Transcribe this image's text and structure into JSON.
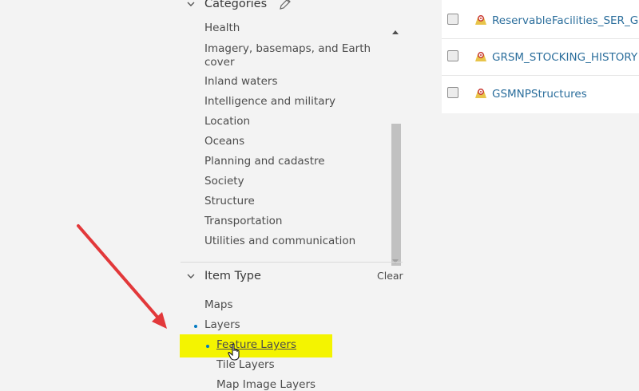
{
  "categories": {
    "heading": "Categories",
    "items": [
      "Health",
      "Imagery, basemaps, and Earth cover",
      "Inland waters",
      "Intelligence and military",
      "Location",
      "Oceans",
      "Planning and cadastre",
      "Society",
      "Structure",
      "Transportation",
      "Utilities and communication"
    ],
    "imagery_line1": "Imagery, basemaps, and Earth",
    "imagery_line2": "cover"
  },
  "item_type": {
    "heading": "Item Type",
    "clear_label": "Clear",
    "maps": "Maps",
    "layers": "Layers",
    "feature_layers": "Feature Layers",
    "tile_layers": "Tile Layers",
    "map_image_layers": "Map Image Layers"
  },
  "results": [
    {
      "title": "ReservableFacilities_SER_GRSM"
    },
    {
      "title": "GRSM_STOCKING_HISTORY"
    },
    {
      "title": "GSMNPStructures"
    }
  ],
  "colors": {
    "accent": "#0079c1",
    "highlight": "#f4f400",
    "annotation_arrow": "#e2383a",
    "link": "#2b6e9c"
  },
  "icons": [
    "chevron-down-icon",
    "pencil-icon",
    "scroll-up-icon",
    "scroll-down-icon",
    "feature-layer-icon",
    "hand-cursor-icon",
    "annotation-arrow"
  ]
}
